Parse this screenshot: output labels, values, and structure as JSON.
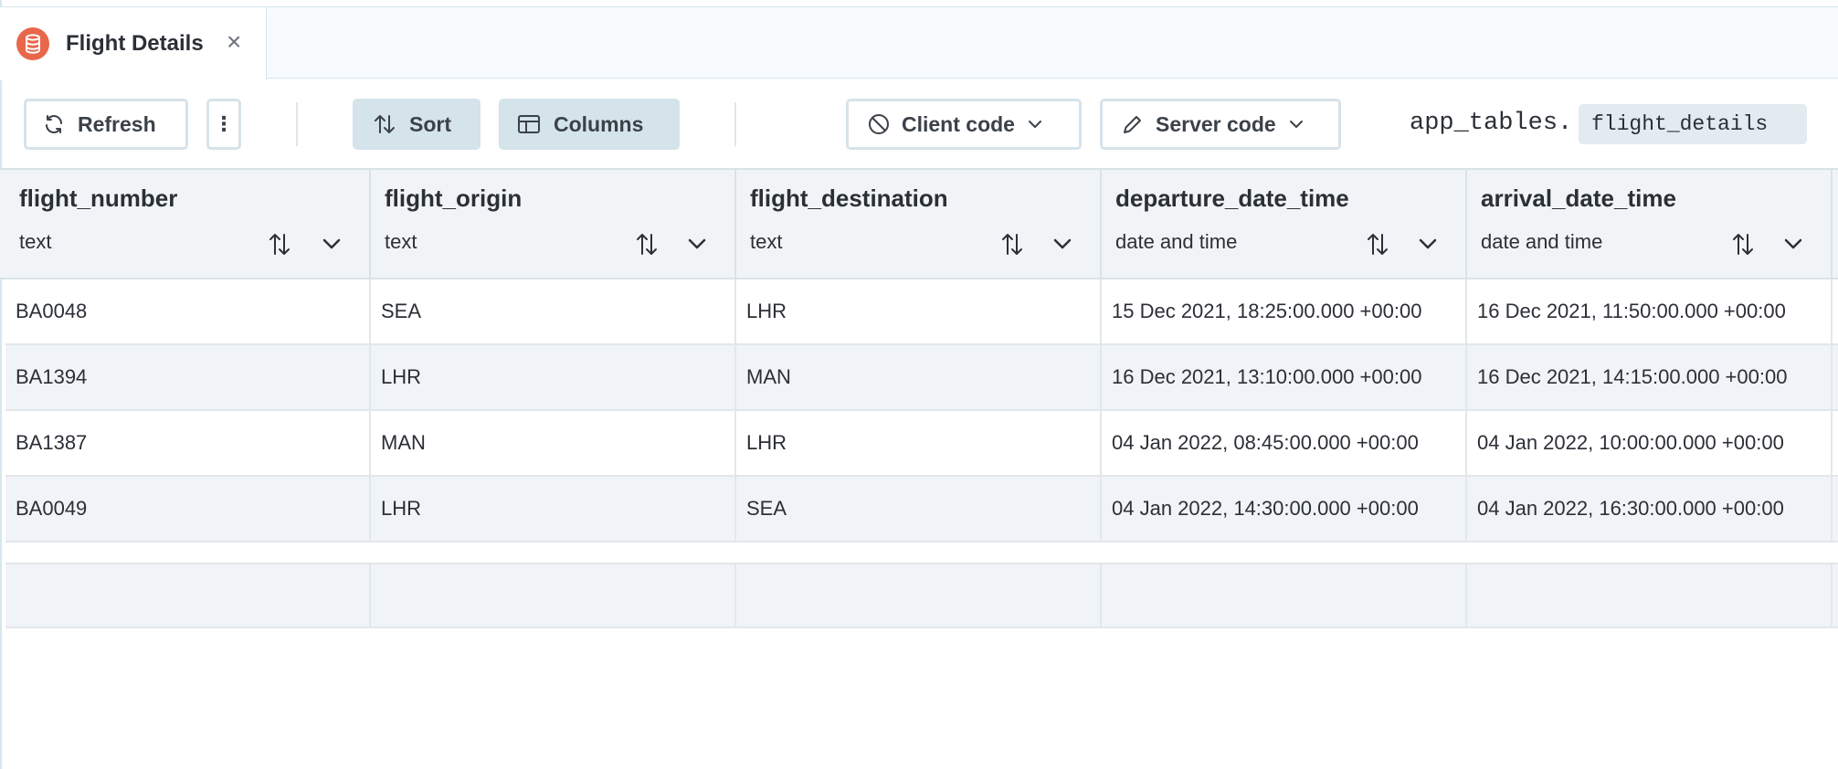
{
  "tab": {
    "title": "Flight Details",
    "icon": "database-icon",
    "close_glyph": "×"
  },
  "toolbar": {
    "refresh_label": "Refresh",
    "more_glyph": "⋮",
    "sort_label": "Sort",
    "columns_label": "Columns",
    "client_code_label": "Client code",
    "server_code_label": "Server code",
    "tables_prefix": "app_tables.",
    "table_name": "flight_details"
  },
  "columns": [
    {
      "name": "flight_number",
      "type": "text"
    },
    {
      "name": "flight_origin",
      "type": "text"
    },
    {
      "name": "flight_destination",
      "type": "text"
    },
    {
      "name": "departure_date_time",
      "type": "date and time"
    },
    {
      "name": "arrival_date_time",
      "type": "date and time"
    }
  ],
  "rows": [
    [
      "BA0048",
      "SEA",
      "LHR",
      "15 Dec 2021, 18:25:00.000 +00:00",
      "16 Dec 2021, 11:50:00.000 +00:00"
    ],
    [
      "BA1394",
      "LHR",
      "MAN",
      "16 Dec 2021, 13:10:00.000 +00:00",
      "16 Dec 2021, 14:15:00.000 +00:00"
    ],
    [
      "BA1387",
      "MAN",
      "LHR",
      "04 Jan 2022, 08:45:00.000 +00:00",
      "04 Jan 2022, 10:00:00.000 +00:00"
    ],
    [
      "BA0049",
      "LHR",
      "SEA",
      "04 Jan 2022, 14:30:00.000 +00:00",
      "04 Jan 2022, 16:30:00.000 +00:00"
    ]
  ],
  "colors": {
    "accent": "#e8674a",
    "button_fill": "#d5e3ea",
    "border": "#d9e2e7"
  }
}
